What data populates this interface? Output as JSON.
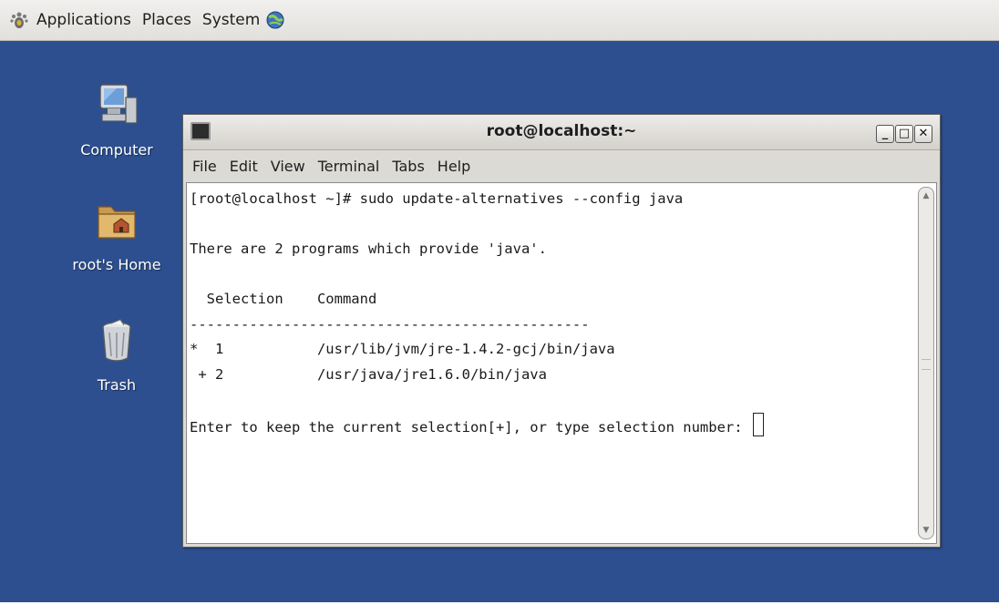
{
  "panel": {
    "menus": [
      "Applications",
      "Places",
      "System"
    ]
  },
  "desktop": {
    "icons": [
      {
        "label": "Computer",
        "icon": "computer-icon"
      },
      {
        "label": "root's Home",
        "icon": "home-folder-icon"
      },
      {
        "label": "Trash",
        "icon": "trash-icon"
      }
    ]
  },
  "window": {
    "title": "root@localhost:~",
    "menus": [
      "File",
      "Edit",
      "View",
      "Terminal",
      "Tabs",
      "Help"
    ],
    "terminal_lines": [
      "[root@localhost ~]# sudo update-alternatives --config java",
      "",
      "There are 2 programs which provide 'java'.",
      "",
      "  Selection    Command",
      "-----------------------------------------------",
      "*  1           /usr/lib/jvm/jre-1.4.2-gcj/bin/java",
      " + 2           /usr/java/jre1.6.0/bin/java",
      "",
      "Enter to keep the current selection[+], or type selection number: "
    ]
  },
  "colors": {
    "desktop_bg": "#2d4f8f",
    "terminal_bg": "#ffffff"
  }
}
